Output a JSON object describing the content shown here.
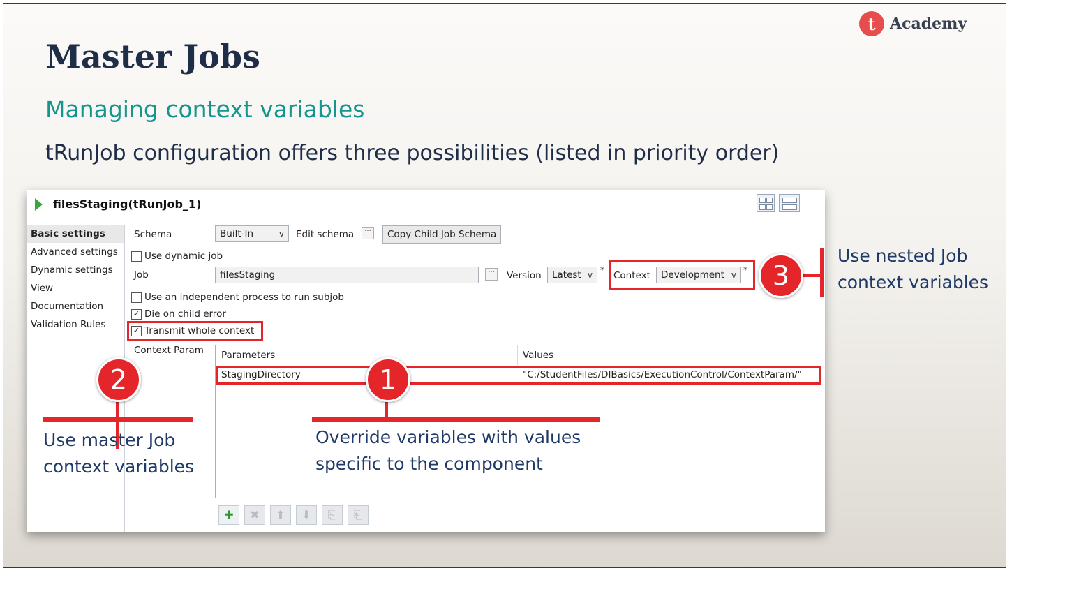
{
  "slide": {
    "logo": {
      "mark": "t",
      "text": "Academy"
    },
    "title": "Master Jobs",
    "subtitle": "Managing context variables",
    "intro": "tRunJob configuration offers three possibilities (listed in priority order)"
  },
  "panel": {
    "title": "filesStaging(tRunJob_1)",
    "sidebar": {
      "items": [
        {
          "label": "Basic settings",
          "active": true
        },
        {
          "label": "Advanced settings"
        },
        {
          "label": "Dynamic settings"
        },
        {
          "label": "View"
        },
        {
          "label": "Documentation"
        },
        {
          "label": "Validation Rules"
        }
      ]
    },
    "form": {
      "schema_label": "Schema",
      "schema_value": "Built-In",
      "edit_schema_label": "Edit schema",
      "dots": "···",
      "copy_child_schema": "Copy Child Job Schema",
      "use_dynamic_job": "Use dynamic job",
      "job_label": "Job",
      "job_value": "filesStaging",
      "version_label": "Version",
      "version_value": "Latest",
      "context_label": "Context",
      "context_value": "Development",
      "required_mark": "*",
      "independent_process": "Use an independent process to run subjob",
      "die_on_child_error": "Die on child error",
      "transmit_whole_context": "Transmit whole context",
      "context_param_label": "Context Param",
      "check_mark": "✓",
      "dropdown_glyph": "v"
    },
    "table": {
      "columns": [
        "Parameters",
        "Values"
      ],
      "rows": [
        {
          "parameter": "StagingDirectory",
          "value": "\"C:/StudentFiles/DIBasics/ExecutionControl/ContextParam/\""
        }
      ]
    },
    "toolbar": {
      "add": "✚",
      "remove": "✖",
      "up": "⬆",
      "down": "⬇",
      "copy": "⎘",
      "paste": "⎗"
    }
  },
  "annotations": {
    "one": {
      "number": "1",
      "text_line1": "Override variables with values",
      "text_line2": "specific to the component"
    },
    "two": {
      "number": "2",
      "text_line1": "Use master Job",
      "text_line2": "context variables"
    },
    "three": {
      "number": "3",
      "text_line1": "Use nested Job",
      "text_line2": "context variables"
    }
  },
  "colors": {
    "accent_red": "#e4262b",
    "title_navy": "#1f2d47",
    "subtitle_teal": "#14958e",
    "annotation_blue": "#1f3a66"
  }
}
